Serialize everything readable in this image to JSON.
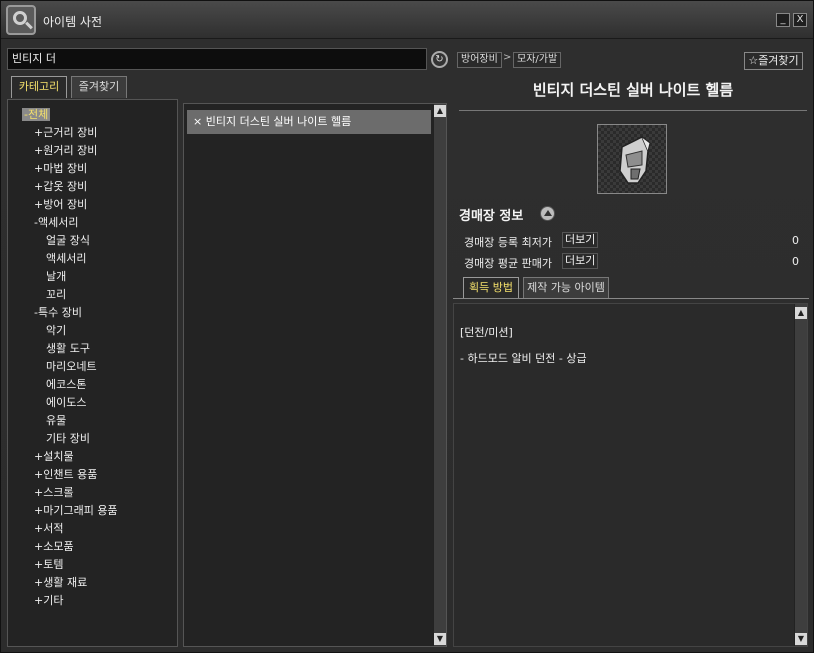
{
  "window": {
    "title": "아이템 사전",
    "minimize_label": "_",
    "close_label": "X"
  },
  "search": {
    "value": "빈티지 더",
    "refresh_symbol": "↻"
  },
  "left_tabs": [
    {
      "label": "카테고리",
      "active": true
    },
    {
      "label": "즐겨찾기",
      "active": false
    }
  ],
  "category_tree": [
    {
      "label": "-전체",
      "level": 0,
      "selected": true
    },
    {
      "label": "+근거리 장비",
      "level": 1
    },
    {
      "label": "+원거리 장비",
      "level": 1
    },
    {
      "label": "+마법 장비",
      "level": 1
    },
    {
      "label": "+갑옷 장비",
      "level": 1
    },
    {
      "label": "+방어 장비",
      "level": 1
    },
    {
      "label": "-액세서리",
      "level": 1
    },
    {
      "label": "얼굴 장식",
      "level": 2
    },
    {
      "label": "액세서리",
      "level": 2
    },
    {
      "label": "날개",
      "level": 2
    },
    {
      "label": "꼬리",
      "level": 2
    },
    {
      "label": "-특수 장비",
      "level": 1
    },
    {
      "label": "악기",
      "level": 2
    },
    {
      "label": "생활 도구",
      "level": 2
    },
    {
      "label": "마리오네트",
      "level": 2
    },
    {
      "label": "에코스톤",
      "level": 2
    },
    {
      "label": "에이도스",
      "level": 2
    },
    {
      "label": "유물",
      "level": 2
    },
    {
      "label": "기타 장비",
      "level": 2
    },
    {
      "label": "+설치물",
      "level": 1
    },
    {
      "label": "+인챈트 용품",
      "level": 1
    },
    {
      "label": "+스크롤",
      "level": 1
    },
    {
      "label": "+마기그래피 용품",
      "level": 1
    },
    {
      "label": "+서적",
      "level": 1
    },
    {
      "label": "+소모품",
      "level": 1
    },
    {
      "label": "+토템",
      "level": 1
    },
    {
      "label": "+생활 재료",
      "level": 1
    },
    {
      "label": "+기타",
      "level": 1
    }
  ],
  "results": [
    {
      "label": "빈티지 더스틴 실버 나이트 헬름",
      "marker": "×"
    }
  ],
  "breadcrumb": {
    "items": [
      "방어장비",
      "모자/가발"
    ],
    "separator": ">"
  },
  "favorite_button": "☆즐겨찾기",
  "item": {
    "name": "빈티지 더스틴 실버 나이트 헬름",
    "image_icon": "helmet-icon"
  },
  "auction": {
    "title": "경매장 정보",
    "rows": [
      {
        "label": "경매장 등록 최저가",
        "button": "더보기",
        "value": "0"
      },
      {
        "label": "경매장 평균 판매가",
        "button": "더보기",
        "value": "0"
      }
    ]
  },
  "detail_tabs": [
    {
      "label": "획득 방법",
      "active": true
    },
    {
      "label": "제작 가능 아이템",
      "active": false
    }
  ],
  "acquisition": {
    "heading": "[던전/미션]",
    "entries": [
      "- 하드모드 알비 던전 - 상급"
    ]
  },
  "colors": {
    "active_tab_text": "#f4e06b",
    "selected_row": "#6c6c6c"
  }
}
